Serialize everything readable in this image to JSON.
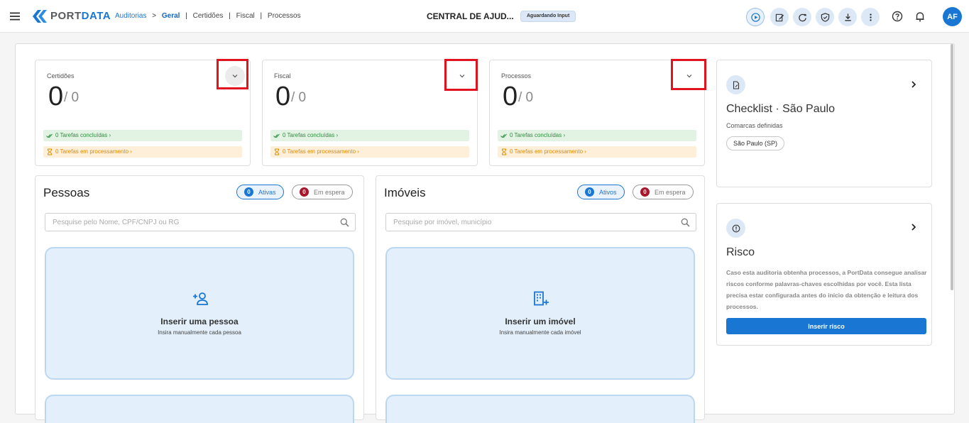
{
  "header": {
    "brand_port": "PORT",
    "brand_data": "DATA",
    "breadcrumb": [
      "Auditorias",
      "Geral",
      "Certidões",
      "Fiscal",
      "Processos"
    ],
    "breadcrumb_arrow": ">",
    "breadcrumb_sep": "|",
    "title": "CENTRAL DE AJUD...",
    "status": "Aguardando Input",
    "user_initials": "AF",
    "tools": [
      "play-icon",
      "edit-icon",
      "refresh-icon",
      "shield-check-icon",
      "download-icon",
      "more-vert-icon"
    ],
    "extra_icons": [
      "help-icon",
      "bell-icon"
    ]
  },
  "stats": [
    {
      "label": "Certidões",
      "count": "0",
      "total": "/ 0",
      "done": "0 Tarefas concluídas  ›",
      "processing": "0 Tarefas em processamento  ›"
    },
    {
      "label": "Fiscal",
      "count": "0",
      "total": "/ 0",
      "done": "0 Tarefas concluídas  ›",
      "processing": "0 Tarefas em processamento  ›"
    },
    {
      "label": "Processos",
      "count": "0",
      "total": "/ 0",
      "done": "0 Tarefas concluídas  ›",
      "processing": "0 Tarefas em processamento  ›"
    }
  ],
  "pessoas": {
    "title": "Pessoas",
    "active_count": "0",
    "active_label": "Ativas",
    "waiting_count": "0",
    "waiting_label": "Em espera",
    "search_placeholder": "Pesquise pelo Nome, CPF/CNPJ ou RG",
    "insert_title": "Inserir uma pessoa",
    "insert_sub": "Insira manualmente cada pessoa"
  },
  "imoveis": {
    "title": "Imóveis",
    "active_count": "0",
    "active_label": "Ativos",
    "waiting_count": "0",
    "waiting_label": "Em espera",
    "search_placeholder": "Pesquise por imóvel, município",
    "insert_title": "Inserir um imóvel",
    "insert_sub": "Insira manualmente cada imóvel"
  },
  "checklist": {
    "title": "Checklist · São Paulo",
    "subtitle": "Comarcas definidas",
    "tag": "São Paulo (SP)"
  },
  "risco": {
    "title": "Risco",
    "description": "Caso esta auditoria obtenha processos, a PortData consegue analisar riscos conforme palavras-chaves escolhidas por você. Esta lista precisa estar configurada antes do início da obtenção e leitura dos processos.",
    "button": "Inserir risco"
  },
  "colors": {
    "accent": "#1976d2",
    "highlight": "#e0131e",
    "success": "#2e8b3e",
    "warning": "#e08a00"
  }
}
